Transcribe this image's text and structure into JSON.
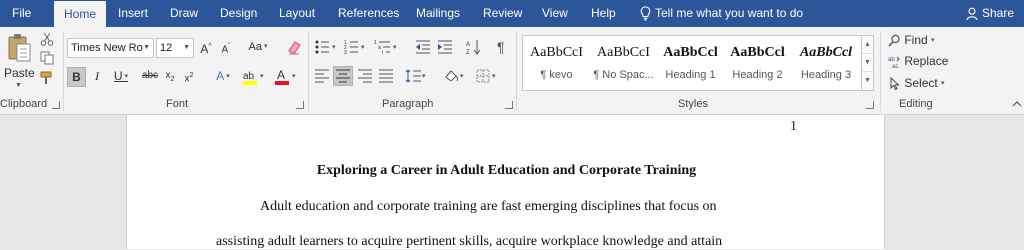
{
  "tabs": [
    "File",
    "Home",
    "Insert",
    "Draw",
    "Design",
    "Layout",
    "References",
    "Mailings",
    "Review",
    "View",
    "Help"
  ],
  "tell_me": "Tell me what you want to do",
  "share": "Share",
  "clipboard": {
    "paste": "Paste",
    "label": "Clipboard"
  },
  "font": {
    "name": "Times New Ro",
    "size": "12",
    "label": "Font"
  },
  "paragraph": {
    "label": "Paragraph"
  },
  "styles": {
    "label": "Styles",
    "items": [
      {
        "preview": "AaBbCcI",
        "name": "¶ kevo"
      },
      {
        "preview": "AaBbCcI",
        "name": "¶ No Spac..."
      },
      {
        "preview": "AaBbCcl",
        "name": "Heading 1"
      },
      {
        "preview": "AaBbCcl",
        "name": "Heading 2"
      },
      {
        "preview": "AaBbCcl",
        "name": "Heading 3"
      }
    ]
  },
  "editing": {
    "find": "Find",
    "replace": "Replace",
    "select": "Select",
    "label": "Editing"
  },
  "document": {
    "page_number": "1",
    "title": "Exploring a Career in Adult Education and Corporate Training",
    "line1": "Adult education and corporate training are fast emerging disciplines that focus on",
    "line2": "assisting adult learners to acquire pertinent skills, acquire workplace knowledge and attain"
  },
  "colors": {
    "tab_bar": "#2b579a",
    "ribbon": "#f3f3f3",
    "highlight": "#ffff00",
    "font_color": "#e81123"
  }
}
